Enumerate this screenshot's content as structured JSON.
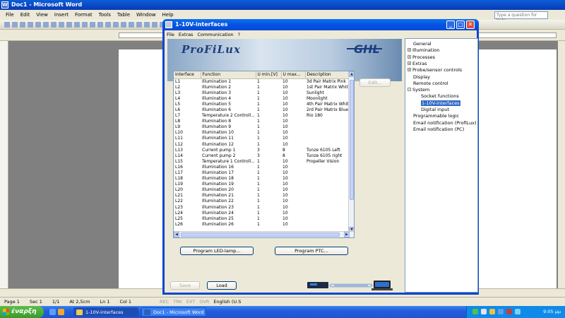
{
  "word": {
    "title": "Doc1 - Microsoft Word",
    "menu": [
      "File",
      "Edit",
      "View",
      "Insert",
      "Format",
      "Tools",
      "Table",
      "Window",
      "Help"
    ],
    "help_placeholder": "Type a question for help",
    "status": {
      "page": "Page 1",
      "sec": "Sec 1",
      "pages": "1/1",
      "at": "At 2,5cm",
      "ln": "Ln 1",
      "col": "Col 1",
      "rec": "REC",
      "trk": "TRK",
      "ext": "EXT",
      "ovr": "OVR",
      "lang": "English (U.S"
    }
  },
  "taskbar": {
    "start": "έναρξη",
    "tasks": [
      "1-10V-interfaces",
      "Doc1 - Microsoft Word"
    ],
    "clock": "9:05 μμ"
  },
  "dialog": {
    "title": "1-10V-interfaces",
    "menu": [
      "File",
      "Extras",
      "Communication",
      "?"
    ],
    "logo_left": "ProFiLux",
    "logo_right": "GHL",
    "table": {
      "headers": [
        "Interface",
        "Function",
        "U min.[V]",
        "U max...",
        "Description"
      ],
      "rows": [
        [
          "L1",
          "Illumination 1",
          "1",
          "10",
          "3d Pair Matrix Pink"
        ],
        [
          "L2",
          "Illumination 2",
          "1",
          "10",
          "1st Pair Matrix White"
        ],
        [
          "L3",
          "Illumination 3",
          "1",
          "10",
          "Sunlight"
        ],
        [
          "L4",
          "Illumination 4",
          "1",
          "10",
          "Moonlight"
        ],
        [
          "L5",
          "Illumination 5",
          "1",
          "10",
          "4th Pair Matrix White"
        ],
        [
          "L6",
          "Illumination 6",
          "1",
          "10",
          "2rd Pair Matrix Blue"
        ],
        [
          "L7",
          "Temperature 2 Controll...",
          "1",
          "10",
          "Rio 180"
        ],
        [
          "L8",
          "Illumination 8",
          "1",
          "10",
          ""
        ],
        [
          "L9",
          "Illumination 9",
          "1",
          "10",
          ""
        ],
        [
          "L10",
          "Illumination 10",
          "1",
          "10",
          ""
        ],
        [
          "L11",
          "Illumination 11",
          "1",
          "10",
          ""
        ],
        [
          "L12",
          "Illumination 12",
          "1",
          "10",
          ""
        ],
        [
          "L13",
          "Current pump 1",
          "3",
          "8",
          "Tunze 6105 Left"
        ],
        [
          "L14",
          "Current pump 2",
          "3",
          "8",
          "Tunze 6105 right"
        ],
        [
          "L15",
          "Temperature 1 Controll...",
          "1",
          "10",
          "Propeller Vision"
        ],
        [
          "L16",
          "Illumination 16",
          "1",
          "10",
          ""
        ],
        [
          "L17",
          "Illumination 17",
          "1",
          "10",
          ""
        ],
        [
          "L18",
          "Illumination 18",
          "1",
          "10",
          ""
        ],
        [
          "L19",
          "Illumination 19",
          "1",
          "10",
          ""
        ],
        [
          "L20",
          "Illumination 20",
          "1",
          "10",
          ""
        ],
        [
          "L21",
          "Illumination 21",
          "1",
          "10",
          ""
        ],
        [
          "L22",
          "Illumination 22",
          "1",
          "10",
          ""
        ],
        [
          "L23",
          "Illumination 23",
          "1",
          "10",
          ""
        ],
        [
          "L24",
          "Illumination 24",
          "1",
          "10",
          ""
        ],
        [
          "L25",
          "Illumination 25",
          "1",
          "10",
          ""
        ],
        [
          "L26",
          "Illumination 26",
          "1",
          "10",
          ""
        ]
      ]
    },
    "edit_button": "Edit...",
    "program_led_button": "Program LED-lamp...",
    "program_ptc_button": "Program PTC...",
    "save_button": "Save",
    "load_button": "Load",
    "tree": [
      {
        "label": "General",
        "level": 0,
        "toggle": ""
      },
      {
        "label": "Illumination",
        "level": 0,
        "toggle": "+"
      },
      {
        "label": "Processes",
        "level": 0,
        "toggle": "+"
      },
      {
        "label": "Extras",
        "level": 0,
        "toggle": "+"
      },
      {
        "label": "Probe/sensor controls",
        "level": 0,
        "toggle": "+"
      },
      {
        "label": "Display",
        "level": 0,
        "toggle": ""
      },
      {
        "label": "Remote control",
        "level": 0,
        "toggle": ""
      },
      {
        "label": "System",
        "level": 0,
        "toggle": "-"
      },
      {
        "label": "Socket functions",
        "level": 1,
        "toggle": ""
      },
      {
        "label": "1-10V-interfaces",
        "level": 1,
        "toggle": "",
        "selected": true
      },
      {
        "label": "Digital input",
        "level": 1,
        "toggle": ""
      },
      {
        "label": "Programmable logic",
        "level": 0,
        "toggle": ""
      },
      {
        "label": "Email notification (ProfiLux)",
        "level": 0,
        "toggle": ""
      },
      {
        "label": "Email notification (PC)",
        "level": 0,
        "toggle": ""
      }
    ]
  }
}
